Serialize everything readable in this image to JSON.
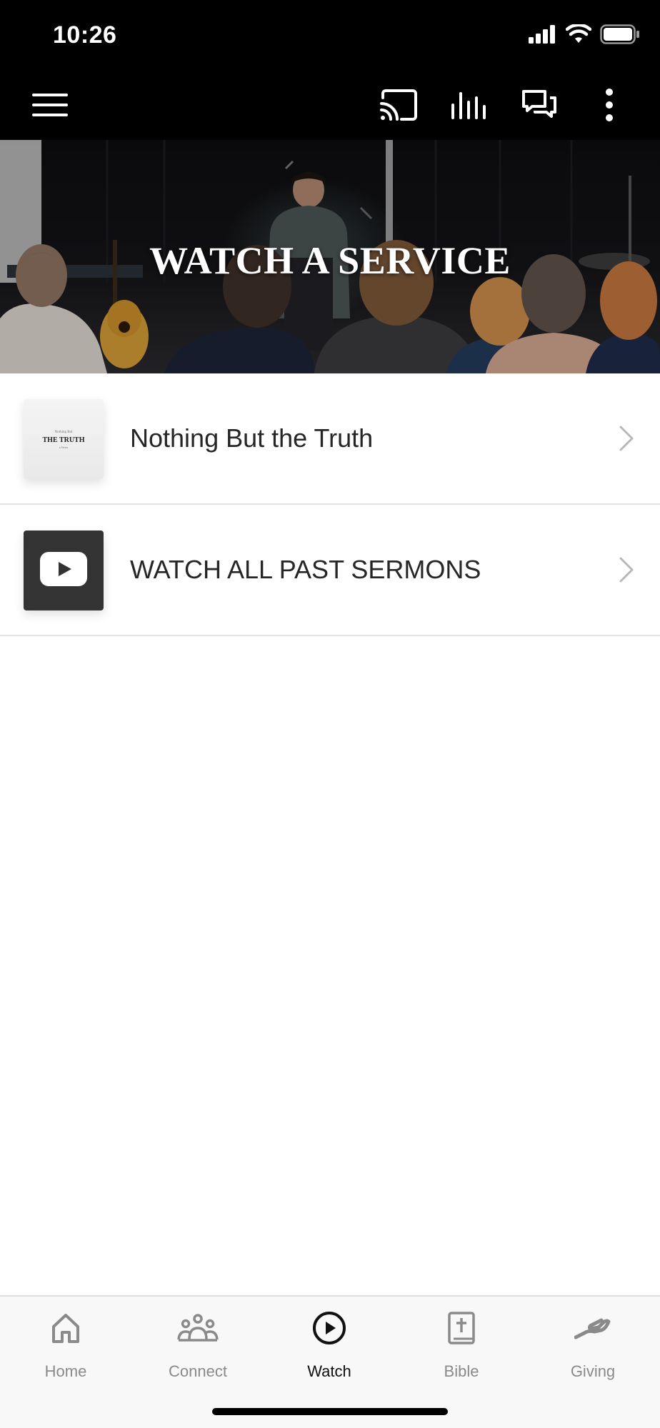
{
  "status_bar": {
    "time": "10:26"
  },
  "app_bar": {
    "icons": [
      "menu-icon",
      "cast-icon",
      "audio-bars-icon",
      "chat-icon",
      "more-vertical-icon"
    ]
  },
  "hero": {
    "title": "WATCH A SERVICE"
  },
  "list": {
    "items": [
      {
        "label": "Nothing But the Truth",
        "thumbnail": {
          "kicker": "Nothing But",
          "title": "THE TRUTH",
          "byline": "a Series"
        }
      },
      {
        "label": "WATCH ALL PAST SERMONS",
        "thumbnail_icon": "youtube-icon"
      }
    ]
  },
  "bottom_nav": {
    "items": [
      {
        "label": "Home",
        "icon": "home-icon"
      },
      {
        "label": "Connect",
        "icon": "people-icon"
      },
      {
        "label": "Watch",
        "icon": "play-circle-icon",
        "active": true
      },
      {
        "label": "Bible",
        "icon": "bible-icon"
      },
      {
        "label": "Giving",
        "icon": "giving-icon"
      }
    ]
  },
  "colors": {
    "bar_background": "#000000",
    "active_nav": "#111111",
    "inactive_nav": "#8a8a8a",
    "divider": "#e2e2e2"
  }
}
